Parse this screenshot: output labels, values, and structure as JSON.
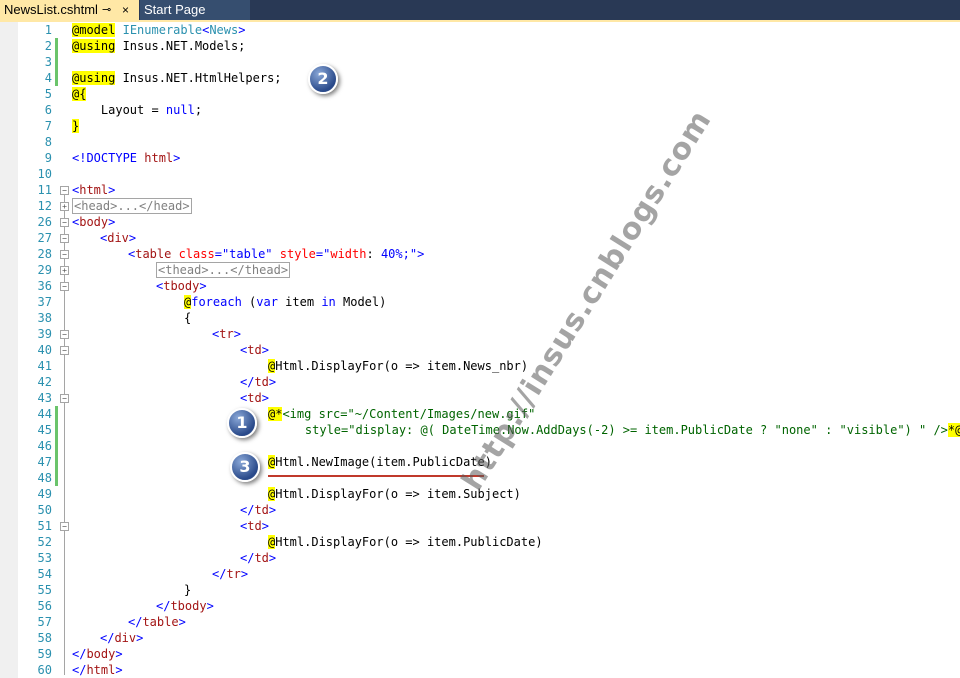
{
  "tabs": {
    "active": {
      "label": "NewsList.cshtml",
      "pin": "⊸",
      "close": "×"
    },
    "inactive": {
      "label": "Start Page"
    }
  },
  "lines": [
    {
      "n": "1"
    },
    {
      "n": "2"
    },
    {
      "n": "3"
    },
    {
      "n": "4"
    },
    {
      "n": "5"
    },
    {
      "n": "6"
    },
    {
      "n": "7"
    },
    {
      "n": "8"
    },
    {
      "n": "9"
    },
    {
      "n": "10"
    },
    {
      "n": "11"
    },
    {
      "n": "12"
    },
    {
      "n": "26"
    },
    {
      "n": "27"
    },
    {
      "n": "28"
    },
    {
      "n": "29"
    },
    {
      "n": "36"
    },
    {
      "n": "37"
    },
    {
      "n": "38"
    },
    {
      "n": "39"
    },
    {
      "n": "40"
    },
    {
      "n": "41"
    },
    {
      "n": "42"
    },
    {
      "n": "43"
    },
    {
      "n": "44"
    },
    {
      "n": "45"
    },
    {
      "n": "46"
    },
    {
      "n": "47"
    },
    {
      "n": "48"
    },
    {
      "n": "49"
    },
    {
      "n": "50"
    },
    {
      "n": "51"
    },
    {
      "n": "52"
    },
    {
      "n": "53"
    },
    {
      "n": "54"
    },
    {
      "n": "55"
    },
    {
      "n": "56"
    },
    {
      "n": "57"
    },
    {
      "n": "58"
    },
    {
      "n": "59"
    },
    {
      "n": "60"
    }
  ],
  "code": {
    "l1a": "@model",
    "l1b": "IEnumerable",
    "l1c": "<",
    "l1d": "News",
    "l1e": ">",
    "l2a": "@using",
    "l2b": " Insus.NET.Models;",
    "l4a": "@using",
    "l4b": " Insus.NET.HtmlHelpers;",
    "l5a": "@{",
    "l6a": "    Layout = ",
    "l6b": "null",
    "l6c": ";",
    "l7a": "}",
    "l9a": "<!DOCTYPE",
    "l9b": " html",
    "l9c": ">",
    "l11a": "<",
    "l11b": "html",
    "l11c": ">",
    "l12a": "<head>...</head>",
    "l26a": "<",
    "l26b": "body",
    "l26c": ">",
    "l27a": "<",
    "l27b": "div",
    "l27c": ">",
    "l28a": "<",
    "l28b": "table",
    "l28c": " class",
    "l28d": "=",
    "l28e": "\"table\"",
    "l28f": " style",
    "l28g": "=",
    "l28h": "\"",
    "l28i": "width",
    "l28j": ": ",
    "l28k": "40%",
    "l28l": ";\"",
    "l28m": ">",
    "l29a": "<thead>...</thead>",
    "l36a": "<",
    "l36b": "tbody",
    "l36c": ">",
    "l37a": "@",
    "l37b": "foreach",
    "l37c": " (",
    "l37d": "var",
    "l37e": " item ",
    "l37f": "in",
    "l37g": " Model)",
    "l38a": "{",
    "l39a": "<",
    "l39b": "tr",
    "l39c": ">",
    "l40a": "<",
    "l40b": "td",
    "l40c": ">",
    "l41a": "@",
    "l41b": "Html.DisplayFor(o => item.News_nbr)",
    "l42a": "</",
    "l42b": "td",
    "l42c": ">",
    "l43a": "<",
    "l43b": "td",
    "l43c": ">",
    "l44a": "@*",
    "l44b": "<img src=\"~/Content/Images/new.gif\"",
    "l45a": "    style=\"display: @( DateTime.Now.AddDays(-2) >= item.PublicDate ? \"none\" : \"visible\") \" />",
    "l45b": "*@",
    "l47a": "@",
    "l47b": "Html.NewImage(item.PublicDate)",
    "l49a": "@",
    "l49b": "Html.DisplayFor(o => item.Subject)",
    "l50a": "</",
    "l50b": "td",
    "l50c": ">",
    "l51a": "<",
    "l51b": "td",
    "l51c": ">",
    "l52a": "@",
    "l52b": "Html.DisplayFor(o => item.PublicDate)",
    "l53a": "</",
    "l53b": "td",
    "l53c": ">",
    "l54a": "</",
    "l54b": "tr",
    "l54c": ">",
    "l55a": "}",
    "l56a": "</",
    "l56b": "tbody",
    "l56c": ">",
    "l57a": "</",
    "l57b": "table",
    "l57c": ">",
    "l58a": "</",
    "l58b": "div",
    "l58c": ">",
    "l59a": "</",
    "l59b": "body",
    "l59c": ">",
    "l60a": "</",
    "l60b": "html",
    "l60c": ">"
  },
  "badges": {
    "b1": "1",
    "b2": "2",
    "b3": "3"
  },
  "watermark": "http://insus.cnblogs.com",
  "colors": {
    "tab_active": "#ffe8a6",
    "tab_bar": "#293955",
    "line_number": "#2b91af",
    "change_marker": "#6bc46b",
    "razor_highlight": "#ffff00",
    "underline": "#c0392b"
  }
}
